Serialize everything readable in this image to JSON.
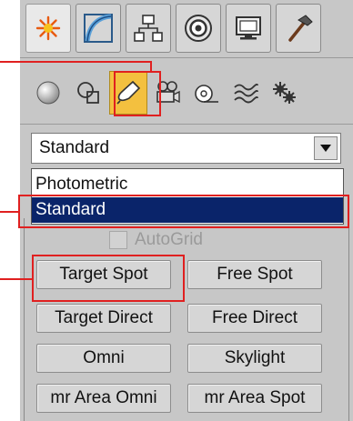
{
  "tabs": [
    {
      "name": "create-tab",
      "icon": "sun-star-icon",
      "active": true
    },
    {
      "name": "modify-tab",
      "icon": "modify-curve-icon",
      "active": false
    },
    {
      "name": "hierarchy-tab",
      "icon": "hierarchy-icon",
      "active": false
    },
    {
      "name": "motion-tab",
      "icon": "motion-circle-icon",
      "active": false
    },
    {
      "name": "display-tab",
      "icon": "display-monitor-icon",
      "active": false
    },
    {
      "name": "utilities-tab",
      "icon": "hammer-icon",
      "active": false
    }
  ],
  "categories": [
    {
      "name": "geometry",
      "icon": "sphere-icon",
      "active": false
    },
    {
      "name": "shapes",
      "icon": "shapes-icon",
      "active": false
    },
    {
      "name": "lights",
      "icon": "light-spot-icon",
      "active": true
    },
    {
      "name": "cameras",
      "icon": "camera-icon",
      "active": false
    },
    {
      "name": "helpers",
      "icon": "helper-tape-icon",
      "active": false
    },
    {
      "name": "space-warps",
      "icon": "space-warp-icon",
      "active": false
    },
    {
      "name": "systems",
      "icon": "systems-gear-icon",
      "active": false
    }
  ],
  "light_type": {
    "selected": "Standard",
    "options": [
      "Photometric",
      "Standard"
    ],
    "highlighted": "Standard"
  },
  "object_type": {
    "autogrid_label": "AutoGrid",
    "autogrid_checked": false,
    "buttons": [
      {
        "label": "Target Spot"
      },
      {
        "label": "Free Spot"
      },
      {
        "label": "Target Direct"
      },
      {
        "label": "Free Direct"
      },
      {
        "label": "Omni"
      },
      {
        "label": "Skylight"
      },
      {
        "label": "mr Area Omni"
      },
      {
        "label": "mr Area Spot"
      }
    ]
  },
  "colors": {
    "callout": "#e02020",
    "active_category": "#f3c03f",
    "selection": "#0a246a"
  }
}
